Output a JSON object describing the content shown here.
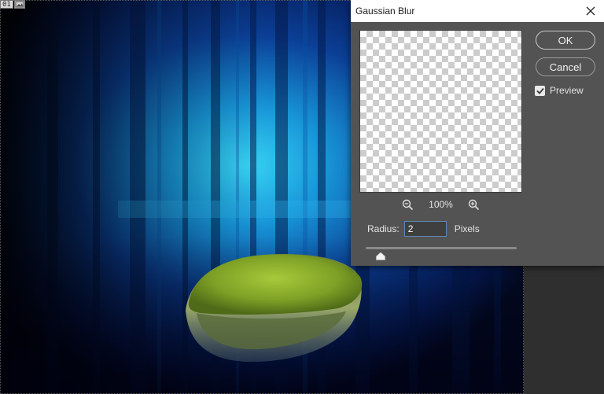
{
  "document": {
    "layer_number": "01",
    "image_icon": "image-icon",
    "scene": {
      "description_icons": [
        "forest-background",
        "mossy-rock"
      ],
      "colors": {
        "glow": "#2ec8f0",
        "deep": "#06123a",
        "moss": "#8db52c"
      }
    }
  },
  "dialog": {
    "title": "Gaussian Blur",
    "close_icon": "close-icon",
    "zoom": {
      "value": "100%",
      "zoom_out_icon": "zoom-out-icon",
      "zoom_in_icon": "zoom-in-icon"
    },
    "radius": {
      "label": "Radius:",
      "value": "2",
      "unit": "Pixels"
    },
    "slider": {
      "fraction": 0.1
    },
    "buttons": {
      "ok": "OK",
      "cancel": "Cancel"
    },
    "preview": {
      "label": "Preview",
      "checked": true
    }
  },
  "colors": {
    "dialog_bg": "#535353",
    "titlebar_bg": "#ffffff",
    "input_border": "#5f87b8"
  }
}
